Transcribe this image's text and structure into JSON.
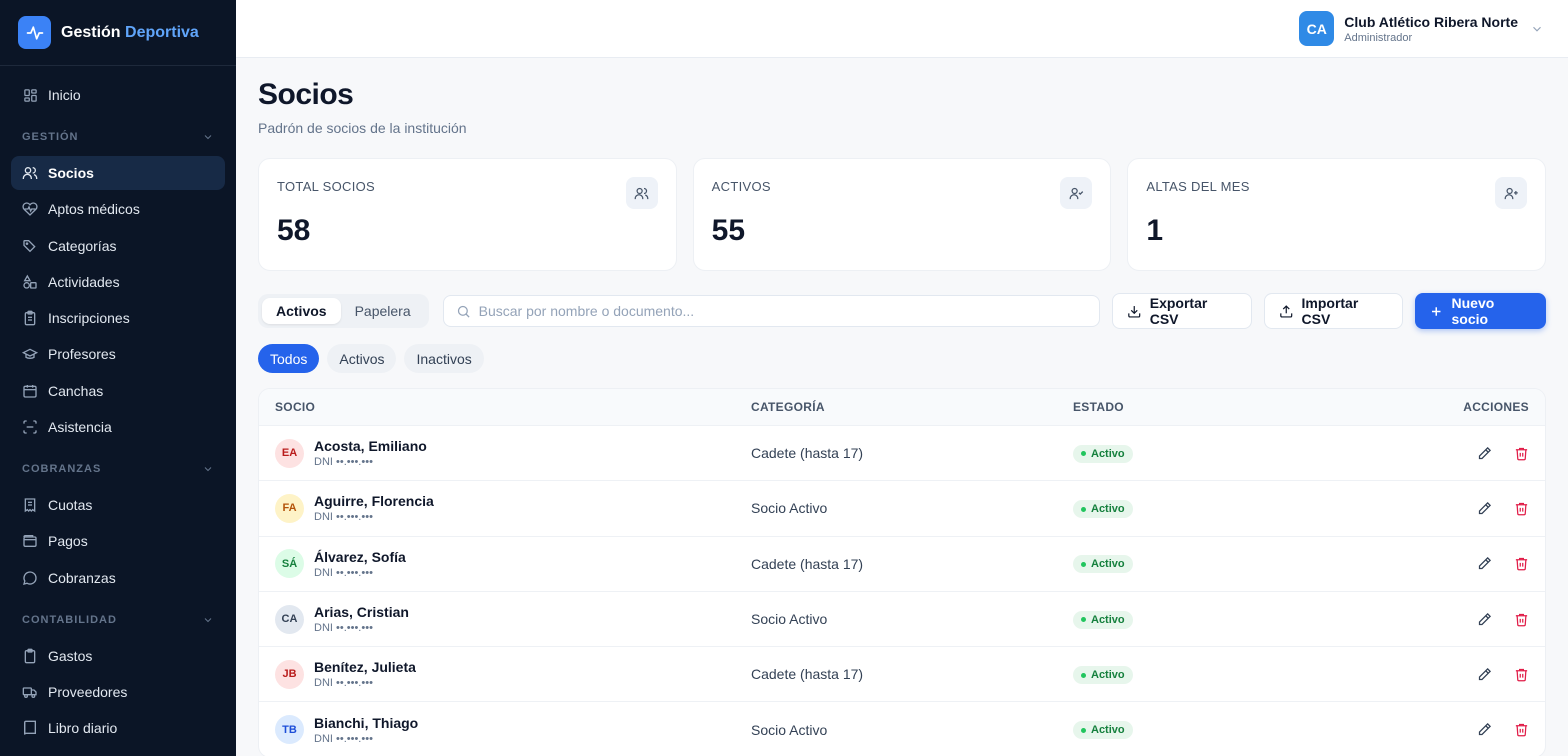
{
  "sidebar": {
    "brand": {
      "word1": "Gestión",
      "word2": "Deportiva"
    },
    "home": "Inicio",
    "sections": [
      {
        "title": "GESTIÓN",
        "items": [
          "Socios",
          "Aptos médicos",
          "Categorías",
          "Actividades",
          "Inscripciones",
          "Profesores",
          "Canchas",
          "Asistencia"
        ]
      },
      {
        "title": "COBRANZAS",
        "items": [
          "Cuotas",
          "Pagos",
          "Cobranzas"
        ]
      },
      {
        "title": "CONTABILIDAD",
        "items": [
          "Gastos",
          "Proveedores",
          "Libro diario"
        ]
      }
    ]
  },
  "topbar": {
    "club_initials": "CA",
    "club_name": "Club Atlético Ribera Norte",
    "role": "Administrador"
  },
  "page": {
    "title": "Socios",
    "subtitle": "Padrón de socios de la institución"
  },
  "stats": [
    {
      "label": "TOTAL SOCIOS",
      "value": "58",
      "icon": "users-icon"
    },
    {
      "label": "ACTIVOS",
      "value": "55",
      "icon": "user-check-icon"
    },
    {
      "label": "ALTAS DEL MES",
      "value": "1",
      "icon": "user-plus-icon"
    }
  ],
  "toolbar": {
    "tab_active": "Activos",
    "tab_trash": "Papelera",
    "search_placeholder": "Buscar por nombre o documento...",
    "export": "Exportar CSV",
    "import": "Importar CSV",
    "new": "Nuevo socio"
  },
  "filters": [
    "Todos",
    "Activos",
    "Inactivos"
  ],
  "table": {
    "headers": {
      "socio": "SOCIO",
      "categoria": "CATEGORÍA",
      "estado": "ESTADO",
      "acciones": "ACCIONES"
    },
    "rows": [
      {
        "initials": "EA",
        "name": "Acosta, Emiliano",
        "doc": "DNI ••.•••.•••",
        "category": "Cadete (hasta 17)",
        "status": "Activo",
        "bg": "#fde2e2",
        "fg": "#b91c1c"
      },
      {
        "initials": "FA",
        "name": "Aguirre, Florencia",
        "doc": "DNI ••.•••.•••",
        "category": "Socio Activo",
        "status": "Activo",
        "bg": "#fef3c7",
        "fg": "#b45309"
      },
      {
        "initials": "SÁ",
        "name": "Álvarez, Sofía",
        "doc": "DNI ••.•••.•••",
        "category": "Cadete (hasta 17)",
        "status": "Activo",
        "bg": "#dcfce7",
        "fg": "#15803d"
      },
      {
        "initials": "CA",
        "name": "Arias, Cristian",
        "doc": "DNI ••.•••.•••",
        "category": "Socio Activo",
        "status": "Activo",
        "bg": "#e2e8f0",
        "fg": "#334155"
      },
      {
        "initials": "JB",
        "name": "Benítez, Julieta",
        "doc": "DNI ••.•••.•••",
        "category": "Cadete (hasta 17)",
        "status": "Activo",
        "bg": "#fde2e2",
        "fg": "#b91c1c"
      },
      {
        "initials": "TB",
        "name": "Bianchi, Thiago",
        "doc": "DNI ••.•••.•••",
        "category": "Socio Activo",
        "status": "Activo",
        "bg": "#dbeafe",
        "fg": "#1d4ed8"
      }
    ]
  },
  "colors": {
    "primary": "#2563eb",
    "sidebar_bg": "#0b1526",
    "active_green": "#15803d",
    "delete_red": "#e11d48"
  }
}
